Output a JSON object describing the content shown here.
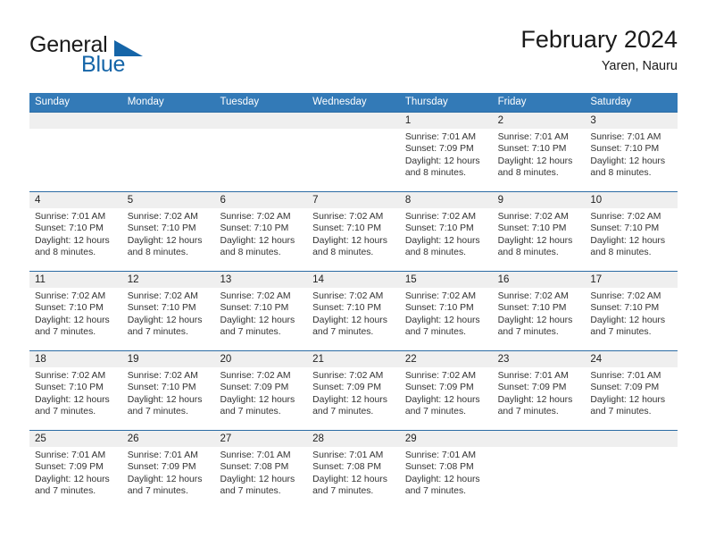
{
  "brand": {
    "word1": "General",
    "word2": "Blue",
    "triangle_color": "#1565a8"
  },
  "header": {
    "title": "February 2024",
    "subtitle": "Yaren, Nauru"
  },
  "colors": {
    "header_blue": "#337ab7",
    "week_divider": "#2c6ca4",
    "date_band": "#efefef"
  },
  "weekdays": [
    "Sunday",
    "Monday",
    "Tuesday",
    "Wednesday",
    "Thursday",
    "Friday",
    "Saturday"
  ],
  "weeks": [
    [
      {
        "day": "",
        "sunrise": "",
        "sunset": "",
        "daylight1": "",
        "daylight2": ""
      },
      {
        "day": "",
        "sunrise": "",
        "sunset": "",
        "daylight1": "",
        "daylight2": ""
      },
      {
        "day": "",
        "sunrise": "",
        "sunset": "",
        "daylight1": "",
        "daylight2": ""
      },
      {
        "day": "",
        "sunrise": "",
        "sunset": "",
        "daylight1": "",
        "daylight2": ""
      },
      {
        "day": "1",
        "sunrise": "Sunrise: 7:01 AM",
        "sunset": "Sunset: 7:09 PM",
        "daylight1": "Daylight: 12 hours",
        "daylight2": "and 8 minutes."
      },
      {
        "day": "2",
        "sunrise": "Sunrise: 7:01 AM",
        "sunset": "Sunset: 7:10 PM",
        "daylight1": "Daylight: 12 hours",
        "daylight2": "and 8 minutes."
      },
      {
        "day": "3",
        "sunrise": "Sunrise: 7:01 AM",
        "sunset": "Sunset: 7:10 PM",
        "daylight1": "Daylight: 12 hours",
        "daylight2": "and 8 minutes."
      }
    ],
    [
      {
        "day": "4",
        "sunrise": "Sunrise: 7:01 AM",
        "sunset": "Sunset: 7:10 PM",
        "daylight1": "Daylight: 12 hours",
        "daylight2": "and 8 minutes."
      },
      {
        "day": "5",
        "sunrise": "Sunrise: 7:02 AM",
        "sunset": "Sunset: 7:10 PM",
        "daylight1": "Daylight: 12 hours",
        "daylight2": "and 8 minutes."
      },
      {
        "day": "6",
        "sunrise": "Sunrise: 7:02 AM",
        "sunset": "Sunset: 7:10 PM",
        "daylight1": "Daylight: 12 hours",
        "daylight2": "and 8 minutes."
      },
      {
        "day": "7",
        "sunrise": "Sunrise: 7:02 AM",
        "sunset": "Sunset: 7:10 PM",
        "daylight1": "Daylight: 12 hours",
        "daylight2": "and 8 minutes."
      },
      {
        "day": "8",
        "sunrise": "Sunrise: 7:02 AM",
        "sunset": "Sunset: 7:10 PM",
        "daylight1": "Daylight: 12 hours",
        "daylight2": "and 8 minutes."
      },
      {
        "day": "9",
        "sunrise": "Sunrise: 7:02 AM",
        "sunset": "Sunset: 7:10 PM",
        "daylight1": "Daylight: 12 hours",
        "daylight2": "and 8 minutes."
      },
      {
        "day": "10",
        "sunrise": "Sunrise: 7:02 AM",
        "sunset": "Sunset: 7:10 PM",
        "daylight1": "Daylight: 12 hours",
        "daylight2": "and 8 minutes."
      }
    ],
    [
      {
        "day": "11",
        "sunrise": "Sunrise: 7:02 AM",
        "sunset": "Sunset: 7:10 PM",
        "daylight1": "Daylight: 12 hours",
        "daylight2": "and 7 minutes."
      },
      {
        "day": "12",
        "sunrise": "Sunrise: 7:02 AM",
        "sunset": "Sunset: 7:10 PM",
        "daylight1": "Daylight: 12 hours",
        "daylight2": "and 7 minutes."
      },
      {
        "day": "13",
        "sunrise": "Sunrise: 7:02 AM",
        "sunset": "Sunset: 7:10 PM",
        "daylight1": "Daylight: 12 hours",
        "daylight2": "and 7 minutes."
      },
      {
        "day": "14",
        "sunrise": "Sunrise: 7:02 AM",
        "sunset": "Sunset: 7:10 PM",
        "daylight1": "Daylight: 12 hours",
        "daylight2": "and 7 minutes."
      },
      {
        "day": "15",
        "sunrise": "Sunrise: 7:02 AM",
        "sunset": "Sunset: 7:10 PM",
        "daylight1": "Daylight: 12 hours",
        "daylight2": "and 7 minutes."
      },
      {
        "day": "16",
        "sunrise": "Sunrise: 7:02 AM",
        "sunset": "Sunset: 7:10 PM",
        "daylight1": "Daylight: 12 hours",
        "daylight2": "and 7 minutes."
      },
      {
        "day": "17",
        "sunrise": "Sunrise: 7:02 AM",
        "sunset": "Sunset: 7:10 PM",
        "daylight1": "Daylight: 12 hours",
        "daylight2": "and 7 minutes."
      }
    ],
    [
      {
        "day": "18",
        "sunrise": "Sunrise: 7:02 AM",
        "sunset": "Sunset: 7:10 PM",
        "daylight1": "Daylight: 12 hours",
        "daylight2": "and 7 minutes."
      },
      {
        "day": "19",
        "sunrise": "Sunrise: 7:02 AM",
        "sunset": "Sunset: 7:10 PM",
        "daylight1": "Daylight: 12 hours",
        "daylight2": "and 7 minutes."
      },
      {
        "day": "20",
        "sunrise": "Sunrise: 7:02 AM",
        "sunset": "Sunset: 7:09 PM",
        "daylight1": "Daylight: 12 hours",
        "daylight2": "and 7 minutes."
      },
      {
        "day": "21",
        "sunrise": "Sunrise: 7:02 AM",
        "sunset": "Sunset: 7:09 PM",
        "daylight1": "Daylight: 12 hours",
        "daylight2": "and 7 minutes."
      },
      {
        "day": "22",
        "sunrise": "Sunrise: 7:02 AM",
        "sunset": "Sunset: 7:09 PM",
        "daylight1": "Daylight: 12 hours",
        "daylight2": "and 7 minutes."
      },
      {
        "day": "23",
        "sunrise": "Sunrise: 7:01 AM",
        "sunset": "Sunset: 7:09 PM",
        "daylight1": "Daylight: 12 hours",
        "daylight2": "and 7 minutes."
      },
      {
        "day": "24",
        "sunrise": "Sunrise: 7:01 AM",
        "sunset": "Sunset: 7:09 PM",
        "daylight1": "Daylight: 12 hours",
        "daylight2": "and 7 minutes."
      }
    ],
    [
      {
        "day": "25",
        "sunrise": "Sunrise: 7:01 AM",
        "sunset": "Sunset: 7:09 PM",
        "daylight1": "Daylight: 12 hours",
        "daylight2": "and 7 minutes."
      },
      {
        "day": "26",
        "sunrise": "Sunrise: 7:01 AM",
        "sunset": "Sunset: 7:09 PM",
        "daylight1": "Daylight: 12 hours",
        "daylight2": "and 7 minutes."
      },
      {
        "day": "27",
        "sunrise": "Sunrise: 7:01 AM",
        "sunset": "Sunset: 7:08 PM",
        "daylight1": "Daylight: 12 hours",
        "daylight2": "and 7 minutes."
      },
      {
        "day": "28",
        "sunrise": "Sunrise: 7:01 AM",
        "sunset": "Sunset: 7:08 PM",
        "daylight1": "Daylight: 12 hours",
        "daylight2": "and 7 minutes."
      },
      {
        "day": "29",
        "sunrise": "Sunrise: 7:01 AM",
        "sunset": "Sunset: 7:08 PM",
        "daylight1": "Daylight: 12 hours",
        "daylight2": "and 7 minutes."
      },
      {
        "day": "",
        "sunrise": "",
        "sunset": "",
        "daylight1": "",
        "daylight2": ""
      },
      {
        "day": "",
        "sunrise": "",
        "sunset": "",
        "daylight1": "",
        "daylight2": ""
      }
    ]
  ]
}
